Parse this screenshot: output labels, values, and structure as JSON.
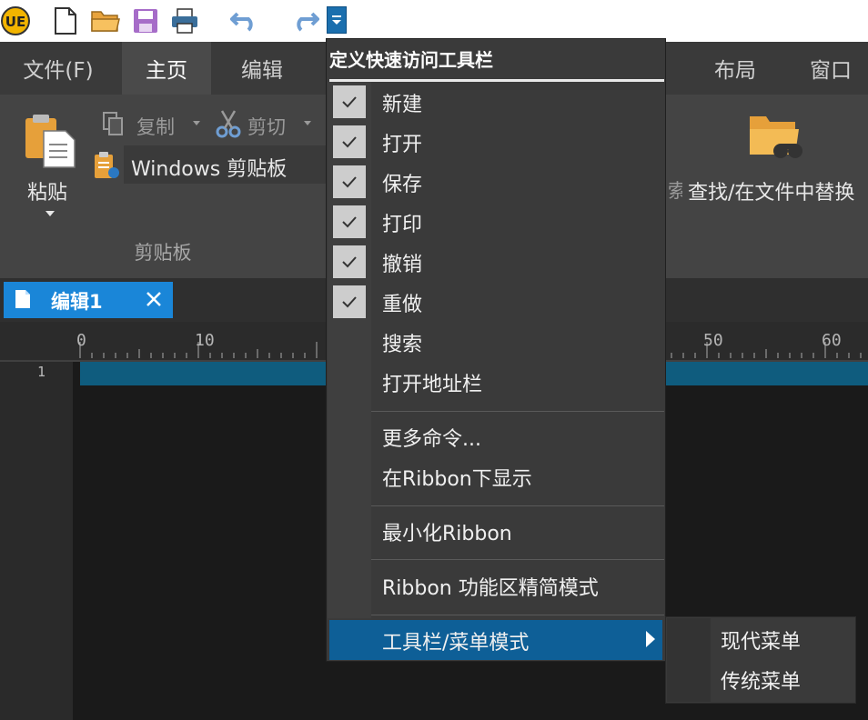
{
  "quick_access": {
    "icons": [
      "ue-logo-icon",
      "new-file-icon",
      "open-folder-icon",
      "save-icon",
      "print-icon",
      "undo-icon",
      "redo-icon",
      "qat-dropdown-icon"
    ]
  },
  "ribbon_tabs": {
    "file": "文件(F)",
    "home": "主页",
    "edit": "编辑",
    "layout": "布局",
    "window": "窗口"
  },
  "ribbon": {
    "paste": "粘贴",
    "copy": "复制",
    "cut": "剪切",
    "windows_clipboard": "Windows 剪贴板",
    "clipboard_group": "剪贴板",
    "find_replace": "查找/在文件中替换",
    "partial_char": "索"
  },
  "document": {
    "tab_label": "编辑1",
    "line_number": "1",
    "ruler_labels": [
      "0",
      "10",
      "50",
      "60"
    ]
  },
  "menu": {
    "title": "定义快速访问工具栏",
    "items": [
      {
        "label": "新建",
        "checked": true
      },
      {
        "label": "打开",
        "checked": true
      },
      {
        "label": "保存",
        "checked": true
      },
      {
        "label": "打印",
        "checked": true
      },
      {
        "label": "撤销",
        "checked": true
      },
      {
        "label": "重做",
        "checked": true
      },
      {
        "label": "搜索",
        "checked": false
      },
      {
        "label": "打开地址栏",
        "checked": false
      }
    ],
    "more_commands": "更多命令...",
    "show_below_ribbon": "在Ribbon下显示",
    "minimize_ribbon": "最小化Ribbon",
    "ribbon_compact": "Ribbon 功能区精简模式",
    "toolbar_menu_mode": "工具栏/菜单模式"
  },
  "submenu": {
    "modern": "现代菜单",
    "classic": "传统菜单"
  },
  "colors": {
    "accent": "#1a86d8",
    "highlight": "#0e5f97",
    "current_line": "#0f5c7e"
  }
}
